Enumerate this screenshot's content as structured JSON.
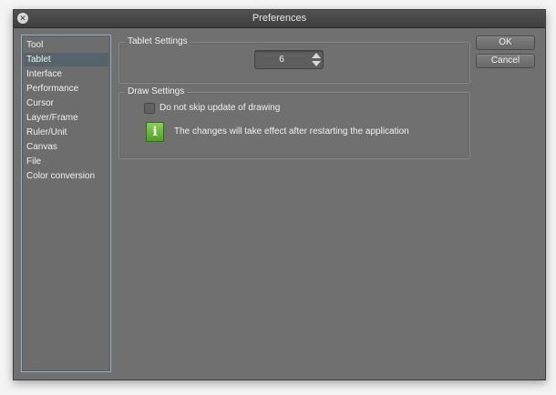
{
  "window": {
    "title": "Preferences",
    "close_glyph": "✕"
  },
  "sidebar": {
    "items": [
      {
        "label": "Tool",
        "selected": false
      },
      {
        "label": "Tablet",
        "selected": true
      },
      {
        "label": "Interface",
        "selected": false
      },
      {
        "label": "Performance",
        "selected": false
      },
      {
        "label": "Cursor",
        "selected": false
      },
      {
        "label": "Layer/Frame",
        "selected": false
      },
      {
        "label": "Ruler/Unit",
        "selected": false
      },
      {
        "label": "Canvas",
        "selected": false
      },
      {
        "label": "File",
        "selected": false
      },
      {
        "label": "Color conversion",
        "selected": false
      }
    ]
  },
  "tablet_settings": {
    "title": "Tablet Settings",
    "spin_value": "6"
  },
  "draw_settings": {
    "title": "Draw Settings",
    "checkbox_label": "Do not skip update of drawing",
    "checkbox_checked": false,
    "info_icon_glyph": "i",
    "info_text": "The changes will take effect after restarting the application"
  },
  "buttons": {
    "ok": "OK",
    "cancel": "Cancel"
  },
  "icons": {
    "close": "close-icon",
    "info": "info-icon",
    "spin_up": "chevron-up-icon",
    "spin_down": "chevron-down-icon"
  },
  "colors": {
    "window_bg": "#707070",
    "selection": "#55646a",
    "list_border": "#8eb8c4",
    "info_green": "#5fb332"
  }
}
